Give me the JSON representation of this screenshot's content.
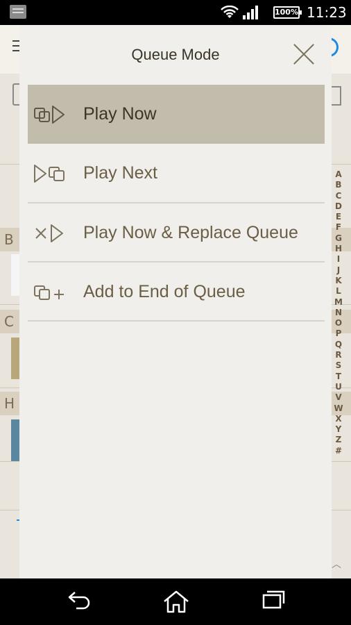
{
  "status_bar": {
    "battery": "100%",
    "clock": "11:23"
  },
  "alpha_index": [
    "A",
    "B",
    "C",
    "D",
    "E",
    "F",
    "G",
    "H",
    "I",
    "J",
    "K",
    "L",
    "M",
    "N",
    "O",
    "P",
    "Q",
    "R",
    "S",
    "T",
    "U",
    "V",
    "W",
    "X",
    "Y",
    "Z",
    "#"
  ],
  "background": {
    "sections": [
      "B",
      "C",
      "H"
    ]
  },
  "dialog": {
    "title": "Queue Mode",
    "options": [
      {
        "label": "Play Now",
        "icon": "play-now-icon",
        "selected": true
      },
      {
        "label": "Play Next",
        "icon": "play-next-icon",
        "selected": false
      },
      {
        "label": "Play Now & Replace Queue",
        "icon": "replace-queue-icon",
        "selected": false
      },
      {
        "label": "Add to End of Queue",
        "icon": "add-to-queue-icon",
        "selected": false
      }
    ]
  },
  "colors": {
    "selected_row": "#c2bcad",
    "dialog_bg": "#f0efeb",
    "text": "#6a5e46"
  }
}
